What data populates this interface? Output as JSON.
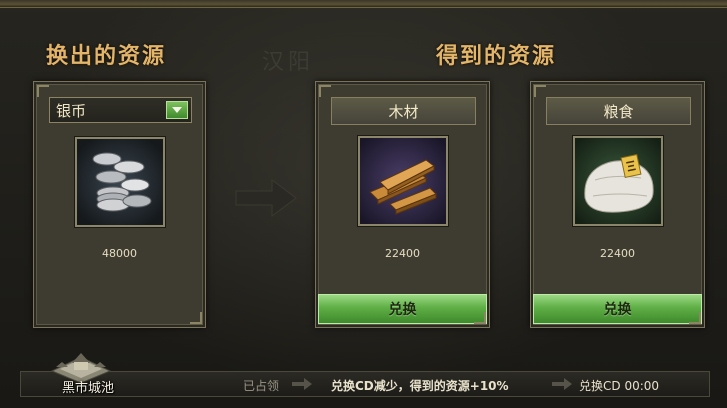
{
  "titles": {
    "out": "换出的资源",
    "in": "得到的资源",
    "watermark": "汉阳"
  },
  "source": {
    "selected": "银币",
    "icon": "silver-coins-icon",
    "amount": "48000"
  },
  "targets": [
    {
      "name": "木材",
      "icon": "wood-planks-icon",
      "amount": "22400",
      "button": "兑换"
    },
    {
      "name": "粮食",
      "icon": "grain-sack-icon",
      "amount": "22400",
      "button": "兑换"
    }
  ],
  "footer": {
    "city": "黑市城池",
    "occupied": "已占领",
    "bonus": "兑换CD减少，得到的资源+10%",
    "cd_label": "兑换CD",
    "cd_value": "00:00"
  },
  "colors": {
    "title": "#e2b56a",
    "button_green": "#5fae46",
    "panel": "#3e3c31"
  }
}
